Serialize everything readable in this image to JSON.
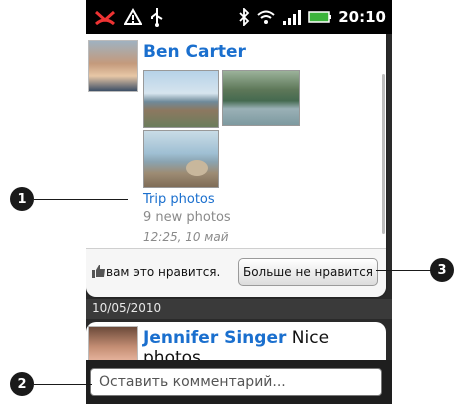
{
  "status": {
    "time": "20:10",
    "icons": [
      "missed-call-icon",
      "warning-icon",
      "usb-icon",
      "bluetooth-icon",
      "wifi-icon",
      "signal-icon",
      "battery-icon"
    ]
  },
  "post": {
    "author": "Ben Carter",
    "album_title": "Trip photos",
    "photo_count": "9 new photos",
    "timestamp": "12:25, 10 май",
    "like_text": "вам это нравится.",
    "unlike_button": "Больше не нравится"
  },
  "date_separator": "10/05/2010",
  "next_post": {
    "author": "Jennifer Singer",
    "text": "Nice photos"
  },
  "comment": {
    "placeholder": "Оставить комментарий..."
  },
  "callouts": [
    "1",
    "2",
    "3"
  ],
  "colors": {
    "link": "#1a6fce",
    "background": "#2a2a2a",
    "callout": "#1a1a1a"
  }
}
